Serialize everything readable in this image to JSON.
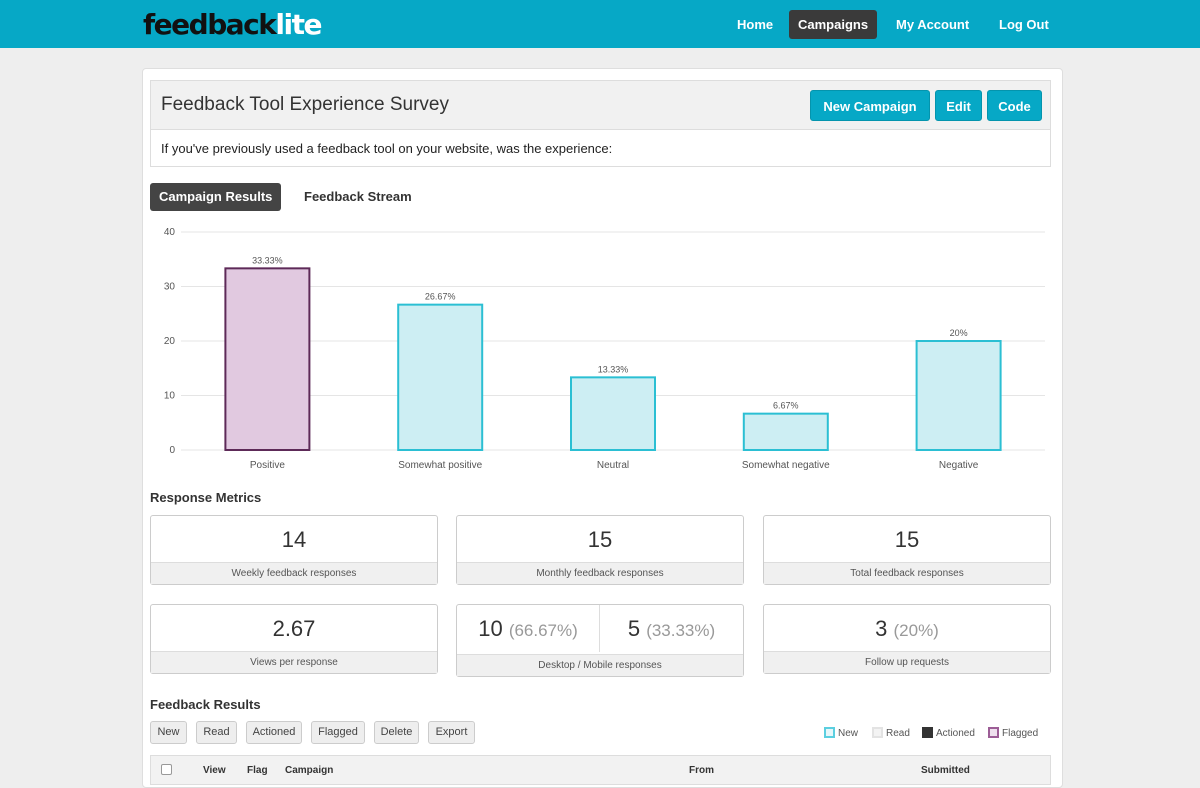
{
  "header": {
    "logo_dark": "feedback",
    "logo_light": "lite",
    "nav": [
      "Home",
      "Campaigns",
      "My Account",
      "Log Out"
    ],
    "active_nav": "Campaigns"
  },
  "campaign": {
    "title": "Feedback Tool Experience Survey",
    "buttons": {
      "new": "New Campaign",
      "edit": "Edit",
      "code": "Code"
    },
    "question": "If you've previously used a feedback tool on your website, was the experience:"
  },
  "tabs": {
    "results": "Campaign Results",
    "stream": "Feedback Stream",
    "active": "Campaign Results"
  },
  "chart_data": {
    "type": "bar",
    "categories": [
      "Positive",
      "Somewhat positive",
      "Neutral",
      "Somewhat negative",
      "Negative"
    ],
    "values": [
      33.33,
      26.67,
      13.33,
      6.67,
      20
    ],
    "value_labels": [
      "33.33%",
      "26.67%",
      "13.33%",
      "6.67%",
      "20%"
    ],
    "ylim": [
      0,
      40
    ],
    "yticks": [
      0,
      10,
      20,
      30,
      40
    ],
    "highlighted_category": "Positive",
    "colors": {
      "fill": "#cdeef3",
      "stroke": "#2bbfd3",
      "highlight_fill": "#e1c9e0",
      "highlight_stroke": "#5d2a58"
    },
    "grid": true
  },
  "metrics": {
    "heading": "Response Metrics",
    "weekly": {
      "value": "14",
      "label": "Weekly feedback responses"
    },
    "monthly": {
      "value": "15",
      "label": "Monthly feedback responses"
    },
    "total": {
      "value": "15",
      "label": "Total feedback responses"
    },
    "views": {
      "value": "2.67",
      "label": "Views per response"
    },
    "devices": {
      "desktop": "10",
      "desktop_pct": "(66.67%)",
      "mobile": "5",
      "mobile_pct": "(33.33%)",
      "label": "Desktop / Mobile responses"
    },
    "followup": {
      "value": "3",
      "pct": "(20%)",
      "label": "Follow up requests"
    }
  },
  "results": {
    "heading": "Feedback Results",
    "filters": [
      "New",
      "Read",
      "Actioned",
      "Flagged",
      "Delete",
      "Export"
    ],
    "legend": [
      {
        "label": "New",
        "color": "#5bcfe0",
        "fill": "#e6f7fa"
      },
      {
        "label": "Read",
        "color": "#e3e3e3",
        "fill": "#f3f3f3"
      },
      {
        "label": "Actioned",
        "color": "#333333",
        "fill": "#333333"
      },
      {
        "label": "Flagged",
        "color": "#9c5d96",
        "fill": "#efe0ee"
      }
    ],
    "columns": [
      "View",
      "Flag",
      "Campaign",
      "From",
      "Submitted"
    ]
  }
}
